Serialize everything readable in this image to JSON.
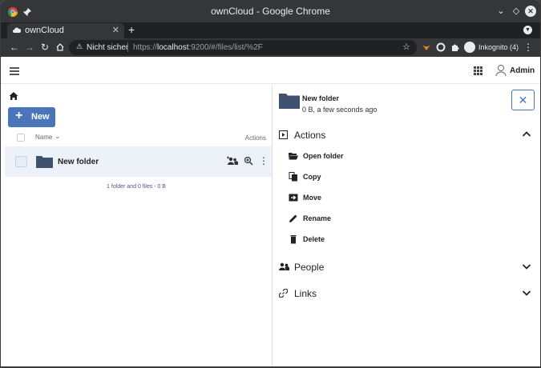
{
  "browser": {
    "window_title": "ownCloud - Google Chrome",
    "tab_title": "ownCloud",
    "new_tab_symbol": "+",
    "security_label": "Nicht sicher",
    "url_scheme": "https://",
    "url_host": "localhost",
    "url_rest": ":9200/#/files/list/%2F",
    "profile_label": "Inkognito (4)"
  },
  "app": {
    "username": "Admin",
    "accent_color": "#4a76b9"
  },
  "files": {
    "new_button_label": "New",
    "column_name": "Name",
    "column_actions": "Actions",
    "rows": [
      {
        "name": "New folder"
      }
    ],
    "summary": "1 folder and 0 files - 0 B"
  },
  "sidebar": {
    "title": "New folder",
    "subtitle": "0 B, a few seconds ago",
    "actions_section": "Actions",
    "actions": [
      {
        "label": "Open folder",
        "icon": "folder-open-icon"
      },
      {
        "label": "Copy",
        "icon": "copy-icon"
      },
      {
        "label": "Move",
        "icon": "move-icon"
      },
      {
        "label": "Rename",
        "icon": "pencil-icon"
      },
      {
        "label": "Delete",
        "icon": "trash-icon"
      }
    ],
    "people_section": "People",
    "links_section": "Links"
  }
}
